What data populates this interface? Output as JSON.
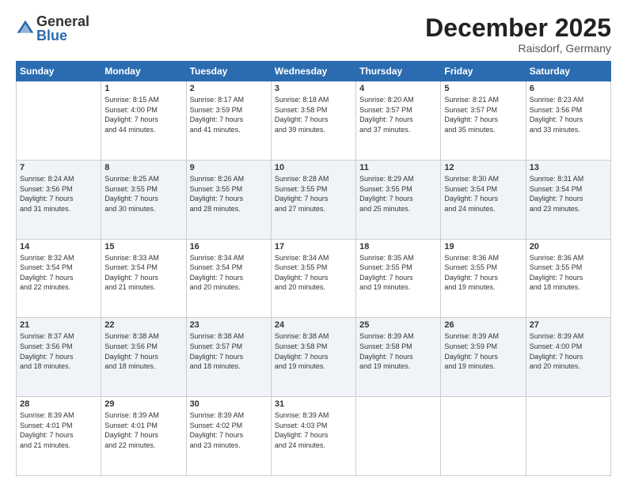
{
  "header": {
    "logo_general": "General",
    "logo_blue": "Blue",
    "month_title": "December 2025",
    "location": "Raisdorf, Germany"
  },
  "weekdays": [
    "Sunday",
    "Monday",
    "Tuesday",
    "Wednesday",
    "Thursday",
    "Friday",
    "Saturday"
  ],
  "weeks": [
    [
      {
        "day": "",
        "info": ""
      },
      {
        "day": "1",
        "info": "Sunrise: 8:15 AM\nSunset: 4:00 PM\nDaylight: 7 hours\nand 44 minutes."
      },
      {
        "day": "2",
        "info": "Sunrise: 8:17 AM\nSunset: 3:59 PM\nDaylight: 7 hours\nand 41 minutes."
      },
      {
        "day": "3",
        "info": "Sunrise: 8:18 AM\nSunset: 3:58 PM\nDaylight: 7 hours\nand 39 minutes."
      },
      {
        "day": "4",
        "info": "Sunrise: 8:20 AM\nSunset: 3:57 PM\nDaylight: 7 hours\nand 37 minutes."
      },
      {
        "day": "5",
        "info": "Sunrise: 8:21 AM\nSunset: 3:57 PM\nDaylight: 7 hours\nand 35 minutes."
      },
      {
        "day": "6",
        "info": "Sunrise: 8:23 AM\nSunset: 3:56 PM\nDaylight: 7 hours\nand 33 minutes."
      }
    ],
    [
      {
        "day": "7",
        "info": "Sunrise: 8:24 AM\nSunset: 3:56 PM\nDaylight: 7 hours\nand 31 minutes."
      },
      {
        "day": "8",
        "info": "Sunrise: 8:25 AM\nSunset: 3:55 PM\nDaylight: 7 hours\nand 30 minutes."
      },
      {
        "day": "9",
        "info": "Sunrise: 8:26 AM\nSunset: 3:55 PM\nDaylight: 7 hours\nand 28 minutes."
      },
      {
        "day": "10",
        "info": "Sunrise: 8:28 AM\nSunset: 3:55 PM\nDaylight: 7 hours\nand 27 minutes."
      },
      {
        "day": "11",
        "info": "Sunrise: 8:29 AM\nSunset: 3:55 PM\nDaylight: 7 hours\nand 25 minutes."
      },
      {
        "day": "12",
        "info": "Sunrise: 8:30 AM\nSunset: 3:54 PM\nDaylight: 7 hours\nand 24 minutes."
      },
      {
        "day": "13",
        "info": "Sunrise: 8:31 AM\nSunset: 3:54 PM\nDaylight: 7 hours\nand 23 minutes."
      }
    ],
    [
      {
        "day": "14",
        "info": "Sunrise: 8:32 AM\nSunset: 3:54 PM\nDaylight: 7 hours\nand 22 minutes."
      },
      {
        "day": "15",
        "info": "Sunrise: 8:33 AM\nSunset: 3:54 PM\nDaylight: 7 hours\nand 21 minutes."
      },
      {
        "day": "16",
        "info": "Sunrise: 8:34 AM\nSunset: 3:54 PM\nDaylight: 7 hours\nand 20 minutes."
      },
      {
        "day": "17",
        "info": "Sunrise: 8:34 AM\nSunset: 3:55 PM\nDaylight: 7 hours\nand 20 minutes."
      },
      {
        "day": "18",
        "info": "Sunrise: 8:35 AM\nSunset: 3:55 PM\nDaylight: 7 hours\nand 19 minutes."
      },
      {
        "day": "19",
        "info": "Sunrise: 8:36 AM\nSunset: 3:55 PM\nDaylight: 7 hours\nand 19 minutes."
      },
      {
        "day": "20",
        "info": "Sunrise: 8:36 AM\nSunset: 3:55 PM\nDaylight: 7 hours\nand 18 minutes."
      }
    ],
    [
      {
        "day": "21",
        "info": "Sunrise: 8:37 AM\nSunset: 3:56 PM\nDaylight: 7 hours\nand 18 minutes."
      },
      {
        "day": "22",
        "info": "Sunrise: 8:38 AM\nSunset: 3:56 PM\nDaylight: 7 hours\nand 18 minutes."
      },
      {
        "day": "23",
        "info": "Sunrise: 8:38 AM\nSunset: 3:57 PM\nDaylight: 7 hours\nand 18 minutes."
      },
      {
        "day": "24",
        "info": "Sunrise: 8:38 AM\nSunset: 3:58 PM\nDaylight: 7 hours\nand 19 minutes."
      },
      {
        "day": "25",
        "info": "Sunrise: 8:39 AM\nSunset: 3:58 PM\nDaylight: 7 hours\nand 19 minutes."
      },
      {
        "day": "26",
        "info": "Sunrise: 8:39 AM\nSunset: 3:59 PM\nDaylight: 7 hours\nand 19 minutes."
      },
      {
        "day": "27",
        "info": "Sunrise: 8:39 AM\nSunset: 4:00 PM\nDaylight: 7 hours\nand 20 minutes."
      }
    ],
    [
      {
        "day": "28",
        "info": "Sunrise: 8:39 AM\nSunset: 4:01 PM\nDaylight: 7 hours\nand 21 minutes."
      },
      {
        "day": "29",
        "info": "Sunrise: 8:39 AM\nSunset: 4:01 PM\nDaylight: 7 hours\nand 22 minutes."
      },
      {
        "day": "30",
        "info": "Sunrise: 8:39 AM\nSunset: 4:02 PM\nDaylight: 7 hours\nand 23 minutes."
      },
      {
        "day": "31",
        "info": "Sunrise: 8:39 AM\nSunset: 4:03 PM\nDaylight: 7 hours\nand 24 minutes."
      },
      {
        "day": "",
        "info": ""
      },
      {
        "day": "",
        "info": ""
      },
      {
        "day": "",
        "info": ""
      }
    ]
  ]
}
